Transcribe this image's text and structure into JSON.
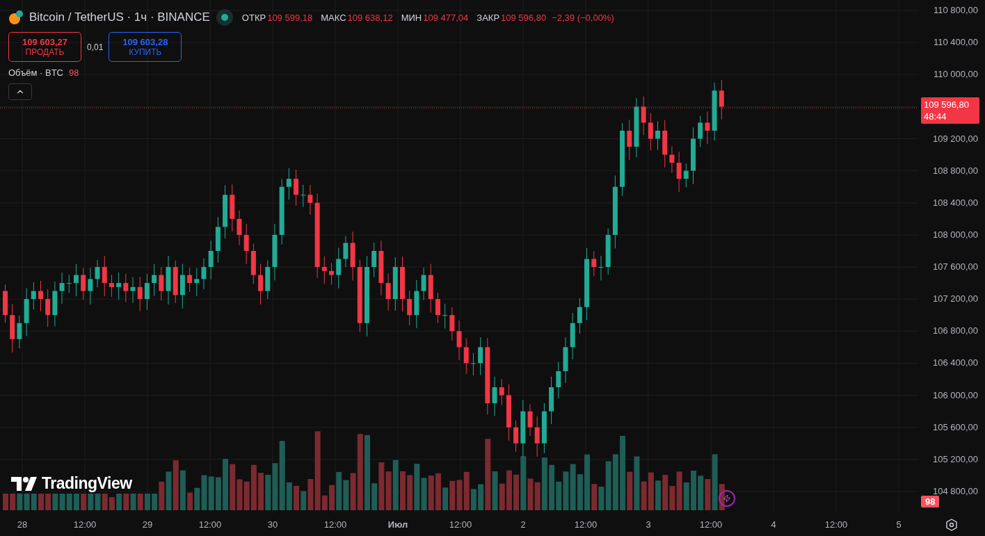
{
  "legend": {
    "symbol": "Bitcoin / TetherUS · 1ч · BINANCE",
    "ohlc": [
      {
        "label": "ОТКР",
        "value": "109 599,18"
      },
      {
        "label": "МАКС",
        "value": "109 638,12"
      },
      {
        "label": "МИН",
        "value": "109 477,04"
      },
      {
        "label": "ЗАКР",
        "value": "109 596,80"
      }
    ],
    "change": "−2,39 (−0,00%)",
    "sell": {
      "price": "109 603,27",
      "label": "ПРОДАТЬ"
    },
    "spread": "0,01",
    "buy": {
      "price": "109 603,28",
      "label": "КУПИТЬ"
    },
    "volume": {
      "label": "Объём · BTC",
      "value": "98"
    }
  },
  "price_axis": {
    "ticks": [
      "110 800,00",
      "110 400,00",
      "110 000,00",
      "109 200,00",
      "108 800,00",
      "108 400,00",
      "108 000,00",
      "107 600,00",
      "107 200,00",
      "106 800,00",
      "106 400,00",
      "106 000,00",
      "105 600,00",
      "105 200,00",
      "104 800,00"
    ],
    "last_price": {
      "price": "109 596,80",
      "countdown": "48:44"
    },
    "volume_tag": "98"
  },
  "time_axis": [
    "28",
    "12:00",
    "29",
    "12:00",
    "30",
    "12:00",
    "Июл",
    "12:00",
    "2",
    "12:00",
    "3",
    "12:00",
    "4",
    "12:00",
    "5"
  ],
  "watermark_text": "TradingView"
}
